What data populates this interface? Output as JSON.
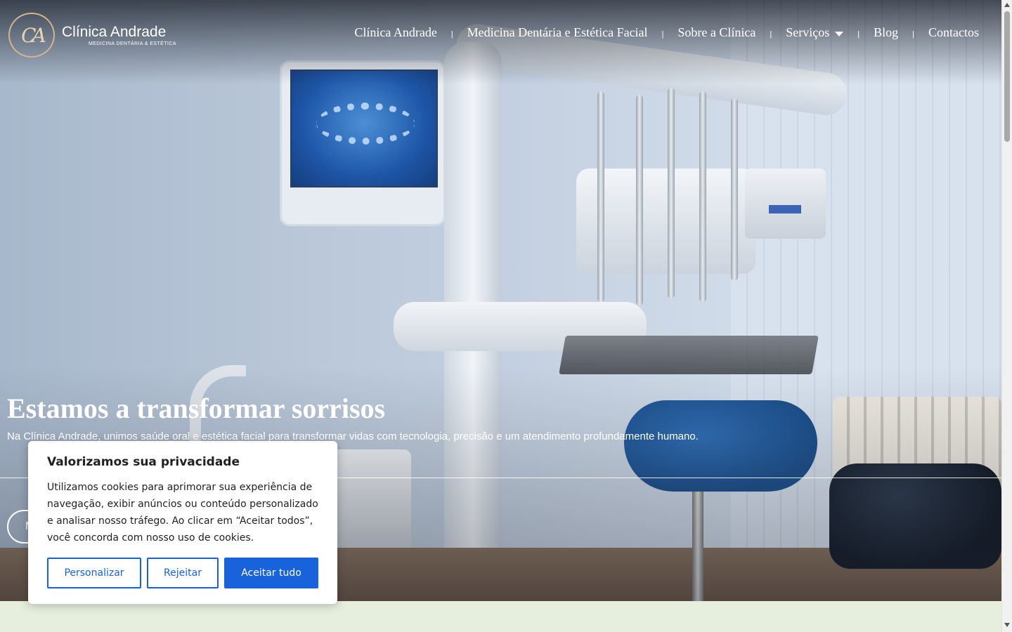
{
  "header": {
    "logo_mark": "CA",
    "logo_name": "Clínica Andrade",
    "logo_tagline": "MEDICINA DENTÁRIA & ESTÉTICA"
  },
  "nav": {
    "items": [
      {
        "label": "Clínica Andrade"
      },
      {
        "label": "Medicina Dentária e Estética Facial"
      },
      {
        "label": "Sobre a Clínica"
      },
      {
        "label": "Serviços",
        "has_dropdown": true
      },
      {
        "label": "Blog"
      },
      {
        "label": "Contactos"
      }
    ],
    "separator": "|"
  },
  "hero": {
    "title": "Estamos a transformar sorrisos",
    "subtitle": "Na Clínica Andrade, unimos saúde oral e estética facial para transformar vidas com tecnologia, precisão e um atendimento profundamente humano.",
    "button_label": "M"
  },
  "cookie_banner": {
    "title": "Valorizamos sua privacidade",
    "text": "Utilizamos cookies para aprimorar sua experiência de navegação, exibir anúncios ou conteúdo personalizado e analisar nosso tráfego. Ao clicar em “Aceitar todos”, você concorda com nosso uso de cookies.",
    "buttons": {
      "customize": "Personalizar",
      "reject": "Rejeitar",
      "accept": "Aceitar tudo"
    }
  },
  "colors": {
    "accent_blue": "#1863dc",
    "logo_gold": "#d2b58a",
    "band_green": "#e6eede"
  },
  "icons": {
    "dropdown": "caret-down-icon",
    "logo": "ca-monogram-icon"
  }
}
